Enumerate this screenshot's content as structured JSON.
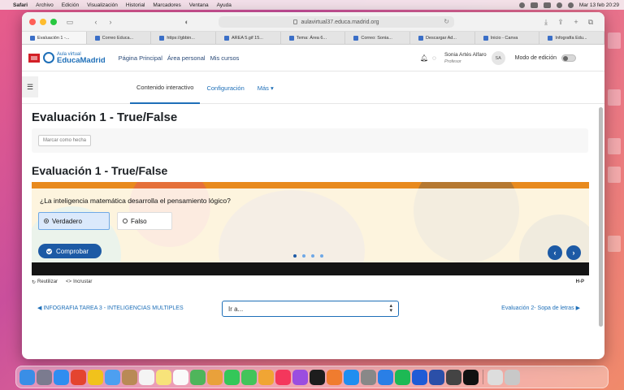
{
  "menubar": {
    "items": [
      "Safari",
      "Archivo",
      "Edición",
      "Visualización",
      "Historial",
      "Marcadores",
      "Ventana",
      "Ayuda"
    ],
    "clock": "Mar 13 feb  20:29"
  },
  "browser": {
    "url": "aulavirtual37.educa.madrid.org",
    "tabs": [
      {
        "label": "Evaluación 1 -..."
      },
      {
        "label": "Correo Educa..."
      },
      {
        "label": "https://gbbin..."
      },
      {
        "label": "AREA 5.gif 15..."
      },
      {
        "label": "Tema: Área 6..."
      },
      {
        "label": "Correo: Sonia..."
      },
      {
        "label": "Descargar Ad..."
      },
      {
        "label": "Inicio - Canva"
      },
      {
        "label": "Infografía Edu..."
      }
    ]
  },
  "site": {
    "logo_small": "Aula virtual",
    "logo_big": "EducaMadrid",
    "nav": [
      "Página Principal",
      "Área personal",
      "Mis cursos"
    ],
    "user_name": "Sonia Artés Alfaro",
    "user_role": "Profesor",
    "avatar_initials": "SA",
    "edit_mode_label": "Modo de edición"
  },
  "secondary_nav": {
    "tabs": [
      "Contenido interactivo",
      "Configuración",
      "Más ▾"
    ]
  },
  "page": {
    "title": "Evaluación 1 - True/False",
    "mark_done": "Marcar como hecha",
    "activity_title": "Evaluación 1 - True/False"
  },
  "h5p": {
    "question": "¿La inteligencia matemática desarrolla el pensamiento lógico?",
    "option_true": "Verdadero",
    "option_false": "Falso",
    "check_label": "Comprobar",
    "prev_arrow": "‹",
    "next_arrow": "›",
    "footer_reuse": "Reutilizar",
    "footer_embed": "Incrustar",
    "footer_logo": "H-P"
  },
  "activity_nav": {
    "prev": "◀ INFOGRAFIA TAREA 3 - INTELIGENCIAS MULTIPLES",
    "jump": "Ir a...",
    "next": "Evaluación 2- Sopa de letras ▶"
  },
  "colors": {
    "brand_blue": "#1e6fb8",
    "h5p_button": "#1d5aa5",
    "desktop_pink": "#e85d8a"
  }
}
